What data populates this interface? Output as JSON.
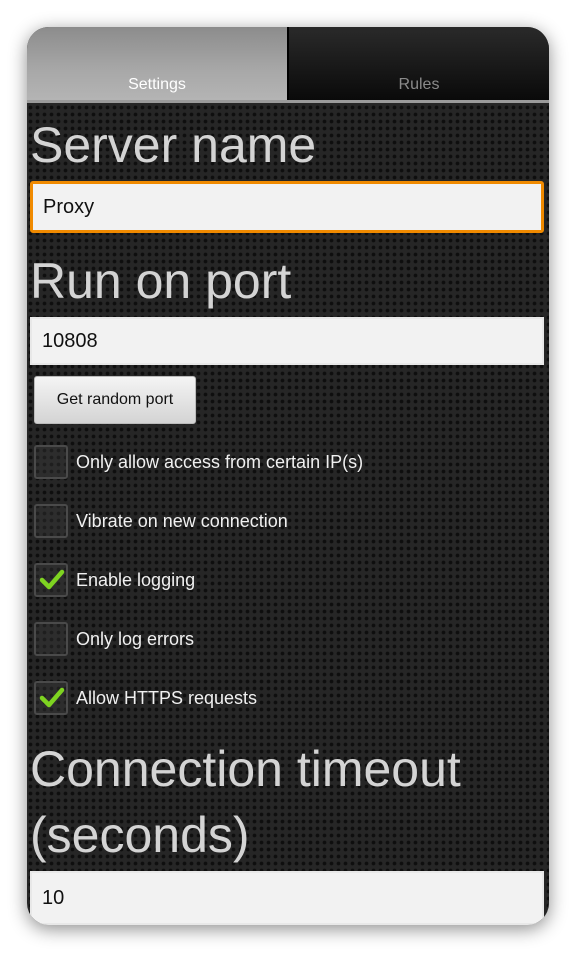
{
  "tabs": [
    {
      "label": "Settings",
      "active": true
    },
    {
      "label": "Rules",
      "active": false
    }
  ],
  "server": {
    "heading": "Server name",
    "value": "Proxy"
  },
  "port": {
    "heading": "Run on port",
    "value": "10808",
    "random_button": "Get random port"
  },
  "options": [
    {
      "label": "Only allow access from certain IP(s)",
      "checked": false
    },
    {
      "label": "Vibrate on new connection",
      "checked": false
    },
    {
      "label": "Enable logging",
      "checked": true
    },
    {
      "label": "Only log errors",
      "checked": false
    },
    {
      "label": "Allow HTTPS requests",
      "checked": true
    }
  ],
  "timeout": {
    "heading_line1": "Connection timeout",
    "heading_line2": "(seconds)",
    "value": "10"
  },
  "colors": {
    "focus_border": "#f08a00",
    "check": "#7ed321"
  },
  "icons": {
    "checkmark": "check-icon"
  }
}
